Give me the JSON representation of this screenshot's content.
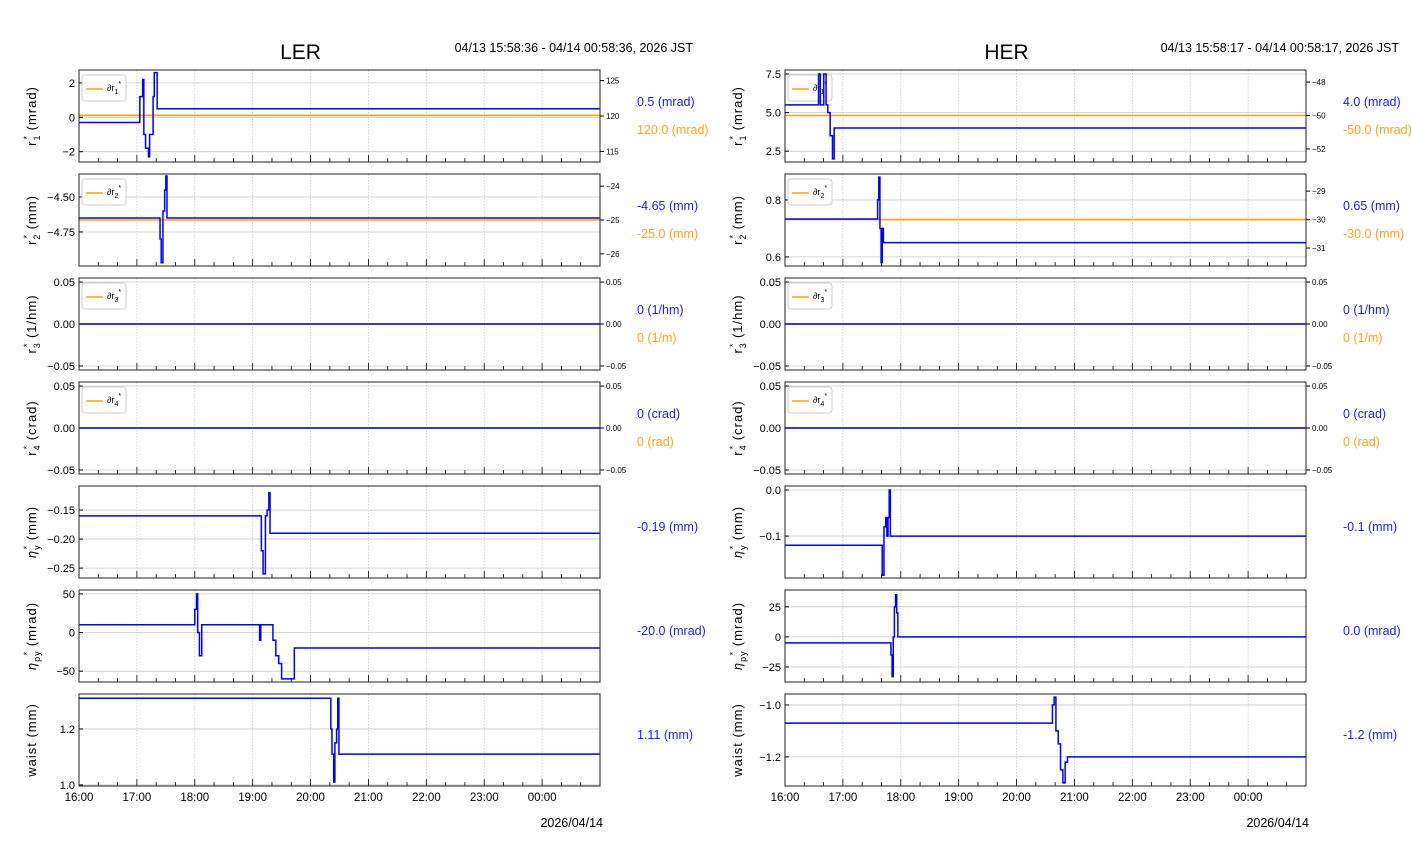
{
  "panels": [
    {
      "title": "LER",
      "time_range": "04/13 15:58:36 - 04/14 00:58:36, 2026 JST",
      "date_label": "2026/04/14",
      "x_ticks": [
        "16:00",
        "17:00",
        "18:00",
        "19:00",
        "20:00",
        "21:00",
        "22:00",
        "23:00",
        "00:00"
      ]
    },
    {
      "title": "HER",
      "time_range": "04/13 15:58:17 - 04/14 00:58:17, 2026 JST",
      "date_label": "2026/04/14",
      "x_ticks": [
        "16:00",
        "17:00",
        "18:00",
        "19:00",
        "20:00",
        "21:00",
        "22:00",
        "23:00",
        "00:00"
      ]
    }
  ],
  "colors": {
    "primary": "#0000ff",
    "secondary": "#ffa500",
    "label_primary": "#1a1aff",
    "label_secondary": "#ffa31a"
  },
  "chart_data": [
    {
      "type": "line",
      "beam": "LER",
      "xlim": [
        16,
        25
      ],
      "ylabel": {
        "sym": "r",
        "sub": "1",
        "star": true,
        "unit": "(mrad)"
      },
      "ylim": [
        -2.6,
        2.75
      ],
      "yticks": [
        2,
        0,
        -2
      ],
      "ytick_labels": [
        "2",
        "0",
        "−2"
      ],
      "series": [
        {
          "name": "r1*",
          "points": [
            [
              16,
              -0.3
            ],
            [
              17.05,
              1.2
            ],
            [
              17.1,
              2.2
            ],
            [
              17.12,
              -1
            ],
            [
              17.15,
              -1.8
            ],
            [
              17.2,
              -2.3
            ],
            [
              17.22,
              -1
            ],
            [
              17.28,
              1.2
            ],
            [
              17.3,
              2.6
            ],
            [
              17.35,
              0.5
            ],
            [
              25,
              0.5
            ]
          ]
        }
      ],
      "secondary": {
        "ylim": [
          113.5,
          126.5
        ],
        "yticks": [
          115,
          120,
          125
        ],
        "ytick_labels": [
          "115",
          "120",
          "125"
        ],
        "name": "∂r",
        "sub": "1",
        "value": 120.1
      },
      "values": [
        "0.5 (mrad)",
        "120.0 (mrad)"
      ]
    },
    {
      "type": "line",
      "beam": "LER",
      "xlim": [
        16,
        25
      ],
      "ylabel": {
        "sym": "r",
        "sub": "2",
        "star": true,
        "unit": "(mm)"
      },
      "ylim": [
        -4.993,
        -4.336
      ],
      "yticks": [
        -4.5,
        -4.75
      ],
      "ytick_labels": [
        "−4.50",
        "−4.75"
      ],
      "series": [
        {
          "name": "r2*",
          "points": [
            [
              16,
              -4.65
            ],
            [
              17.4,
              -4.8
            ],
            [
              17.42,
              -4.97
            ],
            [
              17.45,
              -4.6
            ],
            [
              17.48,
              -4.45
            ],
            [
              17.5,
              -4.35
            ],
            [
              17.52,
              -4.65
            ],
            [
              25,
              -4.65
            ]
          ]
        }
      ],
      "secondary": {
        "ylim": [
          -26.36,
          -23.64
        ],
        "yticks": [
          -24,
          -25,
          -26
        ],
        "ytick_labels": [
          "−24",
          "−25",
          "−26"
        ],
        "name": "∂r",
        "sub": "2",
        "value": -25
      },
      "values": [
        "-4.65 (mm)",
        "-25.0 (mm)"
      ]
    },
    {
      "type": "line",
      "beam": "LER",
      "xlim": [
        16,
        25
      ],
      "ylabel": {
        "sym": "r",
        "sub": "3",
        "star": true,
        "unit": "(1/hm)"
      },
      "ylim": [
        -0.0548,
        0.0548
      ],
      "yticks": [
        0.05,
        0,
        -0.05
      ],
      "ytick_labels": [
        "0.05",
        "0.00",
        "−0.05"
      ],
      "series": [
        {
          "name": "r3*",
          "points": [
            [
              16,
              0
            ],
            [
              25,
              0
            ]
          ]
        }
      ],
      "secondary": {
        "ylim": [
          -0.0548,
          0.0548
        ],
        "yticks": [
          0.05,
          0,
          -0.05
        ],
        "ytick_labels": [
          "0.05",
          "0.00",
          "−0.05"
        ],
        "name": "∂r",
        "sub": "3",
        "value": 0
      },
      "values": [
        "0 (1/hm)",
        "0 (1/m)"
      ]
    },
    {
      "type": "line",
      "beam": "LER",
      "xlim": [
        16,
        25
      ],
      "ylabel": {
        "sym": "r",
        "sub": "4",
        "star": true,
        "unit": "(crad)"
      },
      "ylim": [
        -0.0548,
        0.0548
      ],
      "yticks": [
        0.05,
        0,
        -0.05
      ],
      "ytick_labels": [
        "0.05",
        "0.00",
        "−0.05"
      ],
      "series": [
        {
          "name": "r4*",
          "points": [
            [
              16,
              0
            ],
            [
              25,
              0
            ]
          ]
        }
      ],
      "secondary": {
        "ylim": [
          -0.0548,
          0.0548
        ],
        "yticks": [
          0.05,
          0,
          -0.05
        ],
        "ytick_labels": [
          "0.05",
          "0.00",
          "−0.05"
        ],
        "name": "∂r",
        "sub": "4",
        "value": 0
      },
      "values": [
        "0 (crad)",
        "0 (rad)"
      ]
    },
    {
      "type": "line",
      "beam": "LER",
      "xlim": [
        16,
        25
      ],
      "ylabel": {
        "sym": "η",
        "sub": "y",
        "star": true,
        "unit": "(mm)"
      },
      "ylim": [
        -0.267,
        -0.1086
      ],
      "yticks": [
        -0.15,
        -0.2,
        -0.25
      ],
      "ytick_labels": [
        "−0.15",
        "−0.20",
        "−0.25"
      ],
      "series": [
        {
          "name": "eta_y*",
          "points": [
            [
              16,
              -0.16
            ],
            [
              19.15,
              -0.22
            ],
            [
              19.18,
              -0.26
            ],
            [
              19.22,
              -0.16
            ],
            [
              19.25,
              -0.15
            ],
            [
              19.28,
              -0.12
            ],
            [
              19.3,
              -0.19
            ],
            [
              25,
              -0.19
            ]
          ]
        }
      ],
      "values": [
        "-0.19 (mm)"
      ]
    },
    {
      "type": "line",
      "beam": "LER",
      "xlim": [
        16,
        25
      ],
      "ylabel": {
        "sym": "η",
        "sub": "py",
        "star": true,
        "unit": "(mrad)"
      },
      "ylim": [
        -64,
        55
      ],
      "yticks": [
        50,
        0,
        -50
      ],
      "ytick_labels": [
        "50",
        "0",
        "−50"
      ],
      "series": [
        {
          "name": "eta_py*",
          "points": [
            [
              16,
              10
            ],
            [
              18.0,
              30
            ],
            [
              18.03,
              50
            ],
            [
              18.05,
              0
            ],
            [
              18.08,
              -30
            ],
            [
              18.12,
              10
            ],
            [
              19.12,
              -10
            ],
            [
              19.14,
              10
            ],
            [
              19.35,
              -10
            ],
            [
              19.4,
              -30
            ],
            [
              19.45,
              -40
            ],
            [
              19.5,
              -60
            ],
            [
              19.72,
              -20
            ],
            [
              25,
              -20
            ]
          ]
        }
      ],
      "values": [
        "-20.0 (mrad)"
      ]
    },
    {
      "type": "line",
      "beam": "LER",
      "xlim": [
        16,
        25
      ],
      "ylabel": {
        "sym": "waist",
        "sub": "",
        "star": false,
        "unit": "(mm)"
      },
      "ylim": [
        0.996,
        1.325
      ],
      "yticks": [
        1.2,
        1.0
      ],
      "ytick_labels": [
        "1.2",
        "1.0"
      ],
      "series": [
        {
          "name": "waist",
          "points": [
            [
              16,
              1.31
            ],
            [
              20.35,
              1.2
            ],
            [
              20.37,
              1.11
            ],
            [
              20.4,
              1.01
            ],
            [
              20.42,
              1.15
            ],
            [
              20.45,
              1.2
            ],
            [
              20.47,
              1.31
            ],
            [
              20.49,
              1.11
            ],
            [
              25,
              1.11
            ]
          ]
        }
      ],
      "values": [
        "1.11 (mm)"
      ]
    },
    {
      "type": "line",
      "beam": "HER",
      "xlim": [
        16,
        25
      ],
      "ylabel": {
        "sym": "r",
        "sub": "1",
        "star": true,
        "unit": "(mrad)"
      },
      "ylim": [
        1.8,
        7.76
      ],
      "yticks": [
        7.5,
        5.0,
        2.5
      ],
      "ytick_labels": [
        "7.5",
        "5.0",
        "2.5"
      ],
      "series": [
        {
          "name": "r1*",
          "points": [
            [
              16,
              5.5
            ],
            [
              16.58,
              7.5
            ],
            [
              16.61,
              5.5
            ],
            [
              16.67,
              7.5
            ],
            [
              16.71,
              5.5
            ],
            [
              16.74,
              5.0
            ],
            [
              16.78,
              3.5
            ],
            [
              16.82,
              2.0
            ],
            [
              16.85,
              4.0
            ],
            [
              25,
              4.0
            ]
          ]
        }
      ],
      "secondary": {
        "ylim": [
          -52.78,
          -47.28
        ],
        "yticks": [
          -48,
          -50,
          -52
        ],
        "ytick_labels": [
          "−48",
          "−50",
          "−52"
        ],
        "name": "∂r",
        "sub": "1",
        "value": -50
      },
      "values": [
        "4.0 (mrad)",
        "-50.0 (mrad)"
      ]
    },
    {
      "type": "line",
      "beam": "HER",
      "xlim": [
        16,
        25
      ],
      "ylabel": {
        "sym": "r",
        "sub": "2",
        "star": true,
        "unit": "(mm)"
      },
      "ylim": [
        0.568,
        0.891
      ],
      "yticks": [
        0.8,
        0.6
      ],
      "ytick_labels": [
        "0.8",
        "0.6"
      ],
      "series": [
        {
          "name": "r2*",
          "points": [
            [
              16,
              0.733
            ],
            [
              17.6,
              0.8
            ],
            [
              17.62,
              0.88
            ],
            [
              17.64,
              0.7
            ],
            [
              17.66,
              0.58
            ],
            [
              17.68,
              0.7
            ],
            [
              17.7,
              0.65
            ],
            [
              25,
              0.65
            ]
          ]
        }
      ],
      "secondary": {
        "ylim": [
          -31.63,
          -28.4
        ],
        "yticks": [
          -29,
          -30,
          -31
        ],
        "ytick_labels": [
          "−29",
          "−30",
          "−31"
        ],
        "name": "∂r",
        "sub": "2",
        "value": -30
      },
      "values": [
        "0.65 (mm)",
        "-30.0 (mm)"
      ]
    },
    {
      "type": "line",
      "beam": "HER",
      "xlim": [
        16,
        25
      ],
      "ylabel": {
        "sym": "r",
        "sub": "3",
        "star": true,
        "unit": "(1/hm)"
      },
      "ylim": [
        -0.0548,
        0.0548
      ],
      "yticks": [
        0.05,
        0,
        -0.05
      ],
      "ytick_labels": [
        "0.05",
        "0.00",
        "−0.05"
      ],
      "series": [
        {
          "name": "r3*",
          "points": [
            [
              16,
              0
            ],
            [
              25,
              0
            ]
          ]
        }
      ],
      "secondary": {
        "ylim": [
          -0.0548,
          0.0548
        ],
        "yticks": [
          0.05,
          0,
          -0.05
        ],
        "ytick_labels": [
          "0.05",
          "0.00",
          "−0.05"
        ],
        "name": "∂r",
        "sub": "3",
        "value": 0
      },
      "values": [
        "0 (1/hm)",
        "0 (1/m)"
      ]
    },
    {
      "type": "line",
      "beam": "HER",
      "xlim": [
        16,
        25
      ],
      "ylabel": {
        "sym": "r",
        "sub": "4",
        "star": true,
        "unit": "(crad)"
      },
      "ylim": [
        -0.0548,
        0.0548
      ],
      "yticks": [
        0.05,
        0,
        -0.05
      ],
      "ytick_labels": [
        "0.05",
        "0.00",
        "−0.05"
      ],
      "series": [
        {
          "name": "r4*",
          "points": [
            [
              16,
              0
            ],
            [
              25,
              0
            ]
          ]
        }
      ],
      "secondary": {
        "ylim": [
          -0.0548,
          0.0548
        ],
        "yticks": [
          0.05,
          0,
          -0.05
        ],
        "ytick_labels": [
          "0.05",
          "0.00",
          "−0.05"
        ],
        "name": "∂r",
        "sub": "4",
        "value": 0
      },
      "values": [
        "0 (crad)",
        "0 (rad)"
      ]
    },
    {
      "type": "line",
      "beam": "HER",
      "xlim": [
        16,
        25
      ],
      "ylabel": {
        "sym": "η",
        "sub": "y",
        "star": true,
        "unit": "(mm)"
      },
      "ylim": [
        -0.191,
        0.0087
      ],
      "yticks": [
        0,
        -0.1
      ],
      "ytick_labels": [
        "0.0",
        "−0.1"
      ],
      "series": [
        {
          "name": "eta_y*",
          "points": [
            [
              16,
              -0.12
            ],
            [
              17.68,
              -0.185
            ],
            [
              17.71,
              -0.08
            ],
            [
              17.74,
              -0.06
            ],
            [
              17.76,
              -0.1
            ],
            [
              17.78,
              -0.06
            ],
            [
              17.8,
              0.0
            ],
            [
              17.82,
              -0.1
            ],
            [
              25,
              -0.1
            ]
          ]
        }
      ],
      "values": [
        "-0.1 (mm)"
      ]
    },
    {
      "type": "line",
      "beam": "HER",
      "xlim": [
        16,
        25
      ],
      "ylabel": {
        "sym": "η",
        "sub": "py",
        "star": true,
        "unit": "(mrad)"
      },
      "ylim": [
        -37.5,
        39
      ],
      "yticks": [
        25,
        0,
        -25
      ],
      "ytick_labels": [
        "25",
        "0",
        "−25"
      ],
      "series": [
        {
          "name": "eta_py*",
          "points": [
            [
              16,
              -5
            ],
            [
              17.83,
              -15
            ],
            [
              17.85,
              -33
            ],
            [
              17.87,
              0
            ],
            [
              17.89,
              25
            ],
            [
              17.91,
              35
            ],
            [
              17.93,
              20
            ],
            [
              17.95,
              0
            ],
            [
              25,
              0
            ]
          ]
        }
      ],
      "values": [
        "0.0 (mrad)"
      ]
    },
    {
      "type": "line",
      "beam": "HER",
      "xlim": [
        16,
        25
      ],
      "ylabel": {
        "sym": "waist",
        "sub": "",
        "star": false,
        "unit": "(mm)"
      },
      "ylim": [
        -1.312,
        -0.958
      ],
      "yticks": [
        -1.0,
        -1.2
      ],
      "ytick_labels": [
        "−1.0",
        "−1.2"
      ],
      "series": [
        {
          "name": "waist",
          "points": [
            [
              16,
              -1.07
            ],
            [
              20.62,
              -1.0
            ],
            [
              20.65,
              -0.97
            ],
            [
              20.68,
              -1.1
            ],
            [
              20.72,
              -1.15
            ],
            [
              20.76,
              -1.25
            ],
            [
              20.8,
              -1.3
            ],
            [
              20.84,
              -1.22
            ],
            [
              20.88,
              -1.2
            ],
            [
              25,
              -1.2
            ]
          ]
        }
      ],
      "values": [
        "-1.2 (mm)"
      ]
    }
  ]
}
